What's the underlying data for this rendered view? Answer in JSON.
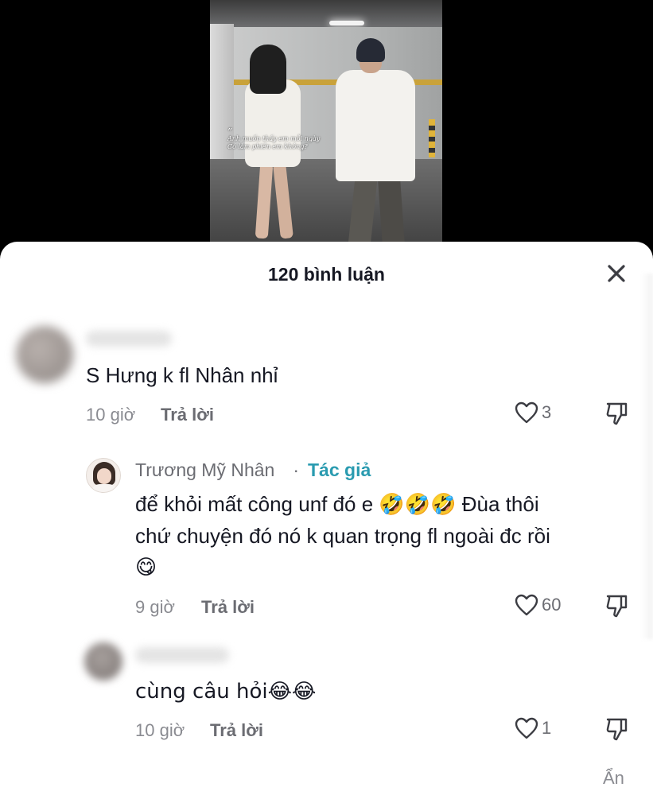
{
  "video": {
    "caption_quote": "”",
    "caption_line1": "Anh muốn thấy em mỗi ngày",
    "caption_line2": "Có làm phiền em không?"
  },
  "sheet": {
    "title": "120 bình luận",
    "close_icon": "close-icon"
  },
  "comments": [
    {
      "text": "S Hưng k fl Nhân nhỉ",
      "time": "10 giờ",
      "reply_label": "Trả lời",
      "likes": "3"
    },
    {
      "author": "Trương Mỹ Nhân",
      "separator": " · ",
      "author_tag": "Tác giả",
      "text_line1": "để khỏi mất công unf đó e 🤣🤣🤣 Đùa thôi",
      "text_line2": "chứ chuyện đó nó k quan trọng fl ngoài đc rồi",
      "text_line3": "😋",
      "time": "9 giờ",
      "reply_label": "Trả lời",
      "likes": "60"
    },
    {
      "text": "cùng câu hỏi😂😂",
      "time": "10 giờ",
      "reply_label": "Trả lời",
      "likes": "1"
    }
  ],
  "footer": {
    "hide_label": "Ẩn"
  },
  "colors": {
    "text_primary": "#161823",
    "text_secondary": "#8a8b91",
    "author_tag": "#2a9bb0",
    "sheet_bg": "#ffffff"
  }
}
